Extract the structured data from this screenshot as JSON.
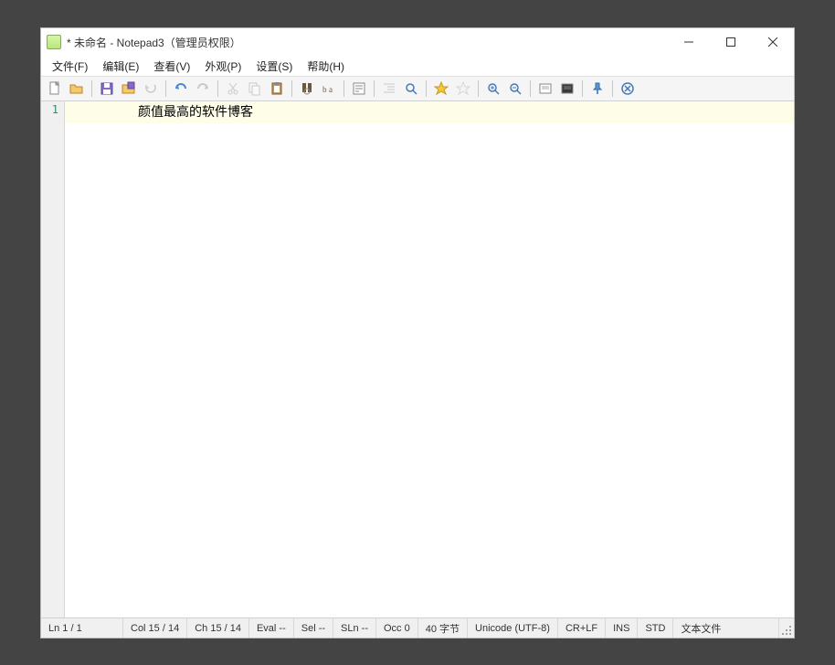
{
  "window": {
    "title": "* 未命名 - Notepad3（管理员权限）"
  },
  "menu": {
    "file": "文件(F)",
    "edit": "编辑(E)",
    "view": "查看(V)",
    "appearance": "外观(P)",
    "settings": "设置(S)",
    "help": "帮助(H)"
  },
  "editor": {
    "line_number": "1",
    "content": "颜值最高的软件博客"
  },
  "status": {
    "ln": "Ln  1 / 1",
    "col": "Col  15 / 14",
    "ch": "Ch  15 / 14",
    "eval": "Eval  --",
    "sel": "Sel  --",
    "sln": "SLn  --",
    "occ": "Occ  0",
    "bytes": "40 字节",
    "encoding": "Unicode (UTF-8)",
    "eol": "CR+LF",
    "ins": "INS",
    "std": "STD",
    "filetype": "文本文件"
  }
}
